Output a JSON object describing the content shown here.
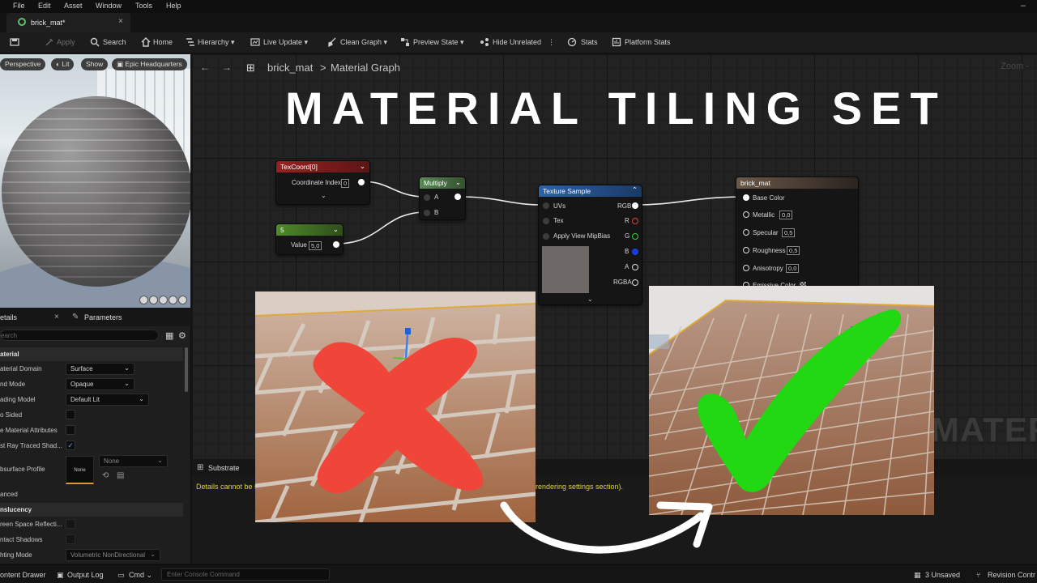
{
  "menu": [
    "File",
    "Edit",
    "Asset",
    "Window",
    "Tools",
    "Help"
  ],
  "tab": {
    "label": "brick_mat*",
    "close": "×"
  },
  "toolbar": {
    "apply": "Apply",
    "search": "Search",
    "home": "Home",
    "hierarchy": "Hierarchy",
    "live_update": "Live Update",
    "clean_graph": "Clean Graph",
    "preview_state": "Preview State",
    "hide_unrelated": "Hide Unrelated",
    "stats": "Stats",
    "platform_stats": "Platform Stats"
  },
  "viewport": {
    "perspective": "Perspective",
    "lit": "Lit",
    "show": "Show",
    "location": "Epic Headquarters"
  },
  "details": {
    "tab_details": "etails",
    "tab_details_close": "×",
    "tab_parameters": "Parameters",
    "search_placeholder": "earch",
    "section_material": "aterial",
    "rows": [
      {
        "label": "aterial Domain",
        "value": "Surface"
      },
      {
        "label": "nd Mode",
        "value": "Opaque"
      },
      {
        "label": "ading Model",
        "value": "Default Lit"
      },
      {
        "label": "o Sided"
      },
      {
        "label": "e Material Attributes"
      },
      {
        "label": "st Ray Traced Shad..."
      }
    ],
    "subsurface_label": "bsurface Profile",
    "subsurface_thumb": "None",
    "subsurface_dropdown": "None",
    "advanced": "anced",
    "section_translucency": "nslucency",
    "trans_rows": [
      {
        "label": "reen Space Reflecti..."
      },
      {
        "label": "ntact Shadows"
      },
      {
        "label": "hting Mode",
        "value": "Volumetric NonDirectional"
      }
    ]
  },
  "graph": {
    "breadcrumb_root": "brick_mat",
    "breadcrumb_sep": ">",
    "breadcrumb_leaf": "Material Graph",
    "title": "MATERIAL TILING SET",
    "zoom": "Zoom -",
    "watermark": "MATERIAL",
    "nodes": {
      "texcoord": {
        "title": "TexCoord[0]",
        "label": "Coordinate Index",
        "value": "0"
      },
      "constant": {
        "title": "5",
        "label": "Value",
        "value": "5,0"
      },
      "multiply": {
        "title": "Multiply",
        "pin_a": "A",
        "pin_b": "B"
      },
      "texture": {
        "title": "Texture Sample",
        "inputs": [
          "UVs",
          "Tex",
          "Apply View MipBias"
        ],
        "outputs": [
          "RGB",
          "R",
          "G",
          "B",
          "A",
          "RGBA"
        ]
      },
      "result": {
        "title": "brick_mat",
        "pins": [
          {
            "label": "Base Color"
          },
          {
            "label": "Metallic",
            "value": "0,0"
          },
          {
            "label": "Specular",
            "value": "0,5"
          },
          {
            "label": "Roughness",
            "value": "0,5"
          },
          {
            "label": "Anisotropy",
            "value": "0,0"
          },
          {
            "label": "Emissive Color"
          }
        ]
      }
    }
  },
  "lower_panel": {
    "title": "Substrate",
    "msg_left": "Details cannot be s",
    "msg_right": "rendering settings section)."
  },
  "status": {
    "content_drawer": "ontent Drawer",
    "output_log": "Output Log",
    "cmd": "Cmd",
    "console_placeholder": "Enter Console Command",
    "unsaved": "3 Unsaved",
    "revision": "Revision Contr"
  },
  "colors": {
    "texcoord_header": "#8b1a1a",
    "constant_header": "#3f6b22",
    "multiply_header": "#466e45",
    "texture_header": "#1f4f88",
    "result_header": "#4a3f38",
    "title_text": "#ffffff",
    "wrong_x": "#f0463a",
    "check": "#22d812",
    "warning_text": "#dcd820"
  }
}
